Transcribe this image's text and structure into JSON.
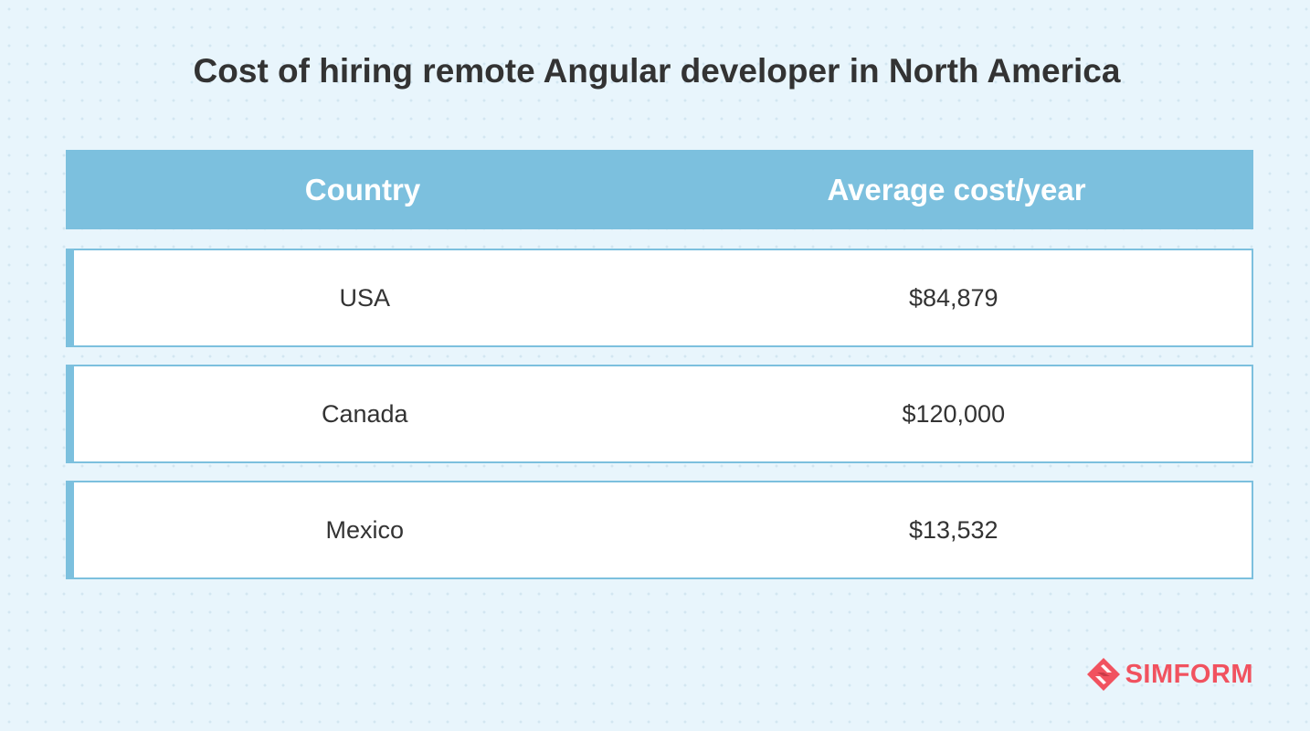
{
  "chart_data": {
    "type": "table",
    "title": "Cost of hiring remote Angular developer in North America",
    "columns": [
      "Country",
      "Average cost/year"
    ],
    "rows": [
      {
        "country": "USA",
        "cost": "$84,879"
      },
      {
        "country": "Canada",
        "cost": "$120,000"
      },
      {
        "country": "Mexico",
        "cost": "$13,532"
      }
    ]
  },
  "brand": {
    "name": "SIMFORM",
    "logo_icon": "simform-logo-icon",
    "color": "#f1525f"
  },
  "colors": {
    "header_bg": "#7cc0de",
    "page_bg": "#e8f5fc",
    "text": "#333333"
  }
}
